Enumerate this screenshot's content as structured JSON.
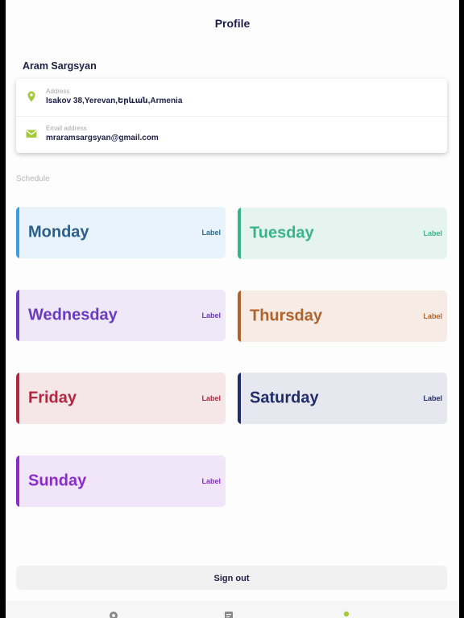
{
  "header": {
    "title": "Profile"
  },
  "user": {
    "name": "Aram Sargsyan"
  },
  "contact": {
    "address_label": "Address",
    "address_value": "Isakov 38,Yerevan,Երևան,Armenia",
    "address_icon": "location-pin-icon",
    "email_label": "Email address",
    "email_value": "mraramsargsyan@gmail.com",
    "email_icon": "mail-icon",
    "icon_color": "#a4c93a"
  },
  "schedule": {
    "heading": "Schedule",
    "days": [
      {
        "name": "Monday",
        "label": "Label",
        "text_color": "#2c5f8a",
        "bar_color": "#3b9ee0",
        "bg_color": "#e8f3fb",
        "label_color": "#2c6a94"
      },
      {
        "name": "Tuesday",
        "label": "Label",
        "text_color": "#3bb38a",
        "bar_color": "#3bb38a",
        "bg_color": "#e6f4ef",
        "label_color": "#3bb38a"
      },
      {
        "name": "Wednesday",
        "label": "Label",
        "text_color": "#6a3bc0",
        "bar_color": "#6a3bc0",
        "bg_color": "#efe8f8",
        "label_color": "#6a3bc0"
      },
      {
        "name": "Thursday",
        "label": "Label",
        "text_color": "#b0622a",
        "bar_color": "#b0622a",
        "bg_color": "#f7ece5",
        "label_color": "#b0622a"
      },
      {
        "name": "Friday",
        "label": "Label",
        "text_color": "#b0273f",
        "bar_color": "#b0273f",
        "bg_color": "#f5e6e8",
        "label_color": "#b0273f"
      },
      {
        "name": "Saturday",
        "label": "Label",
        "text_color": "#1f2c6a",
        "bar_color": "#1f2c6a",
        "bg_color": "#e7e8ef",
        "label_color": "#1f2c6a"
      },
      {
        "name": "Sunday",
        "label": "Label",
        "text_color": "#8a2ccc",
        "bar_color": "#8a2ccc",
        "bg_color": "#f1e6f9",
        "label_color": "#8a2ccc"
      }
    ]
  },
  "actions": {
    "signout_label": "Sign out"
  },
  "tabbar": {
    "tabs": [
      {
        "icon": "home-icon"
      },
      {
        "icon": "document-icon"
      },
      {
        "icon": "profile-icon",
        "active_color": "#a4c93a"
      }
    ]
  }
}
